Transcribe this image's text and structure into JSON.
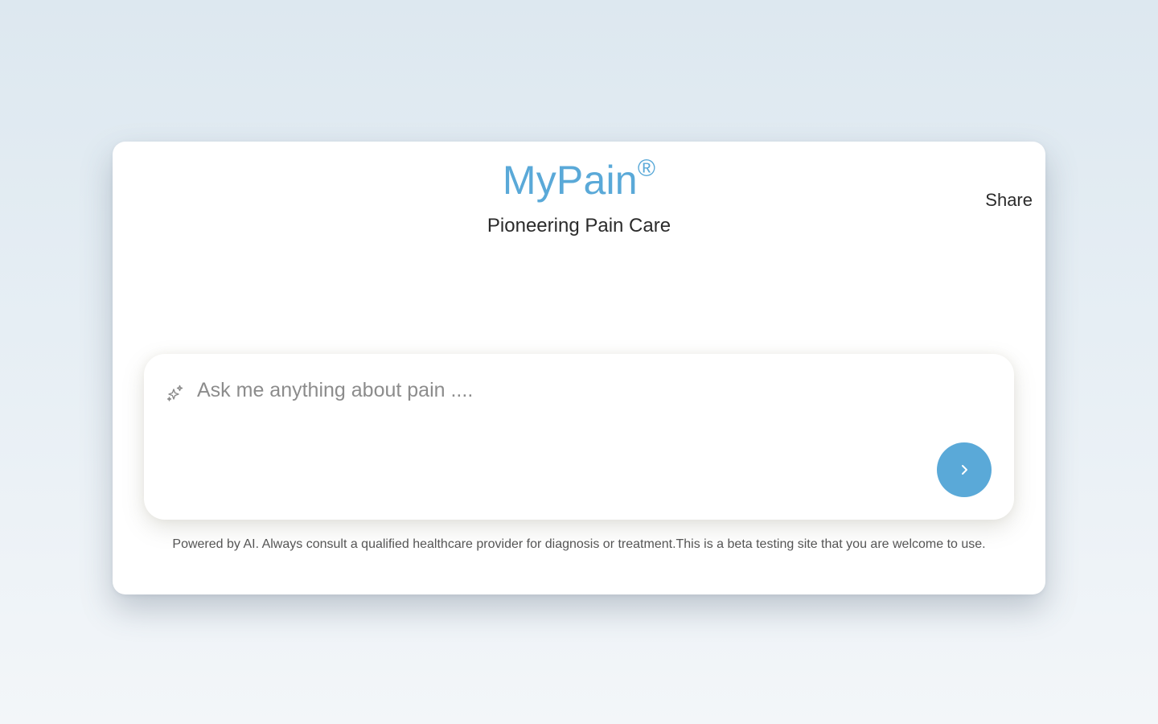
{
  "header": {
    "brand_name": "MyPain",
    "brand_mark": "®",
    "tagline": "Pioneering Pain Care",
    "share_label": "Share"
  },
  "chat": {
    "placeholder": "Ask me anything about pain ....",
    "input_icon": "sparkle-icon",
    "send_icon": "chevron-right-icon"
  },
  "footer": {
    "disclaimer": "Powered by AI. Always consult a qualified healthcare provider for diagnosis or treatment.This is a beta testing site that you are welcome to use."
  },
  "colors": {
    "brand": "#5aa9d8",
    "send_button": "#5aa9d8",
    "background_top": "#dde8f0",
    "background_bottom": "#f3f6f9"
  }
}
